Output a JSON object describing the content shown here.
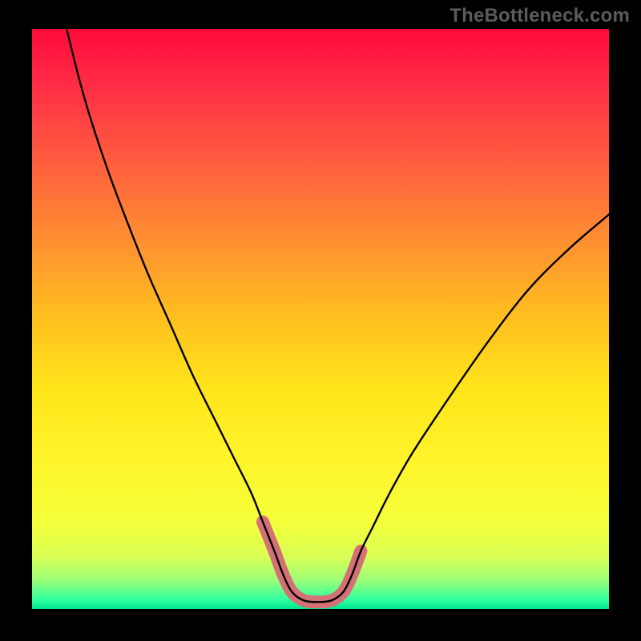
{
  "watermark": {
    "text": "TheBottleneck.com"
  },
  "gradient": {
    "stops": [
      {
        "offset": 0.0,
        "color": "#ff0a3a"
      },
      {
        "offset": 0.1,
        "color": "#ff2e46"
      },
      {
        "offset": 0.22,
        "color": "#ff5a3f"
      },
      {
        "offset": 0.35,
        "color": "#ff8a33"
      },
      {
        "offset": 0.5,
        "color": "#ffc01f"
      },
      {
        "offset": 0.62,
        "color": "#ffe51a"
      },
      {
        "offset": 0.74,
        "color": "#fff42a"
      },
      {
        "offset": 0.85,
        "color": "#f4ff3a"
      },
      {
        "offset": 0.91,
        "color": "#d9ff55"
      },
      {
        "offset": 0.95,
        "color": "#9dff78"
      },
      {
        "offset": 0.985,
        "color": "#2dffa0"
      },
      {
        "offset": 1.0,
        "color": "#00e58b"
      }
    ]
  },
  "chart_data": {
    "type": "line",
    "title": "",
    "xlabel": "",
    "ylabel": "",
    "xlim": [
      0,
      100
    ],
    "ylim": [
      0,
      100
    ],
    "legend": false,
    "series": [
      {
        "name": "bottleneck-curve",
        "color": "#000000",
        "x": [
          6,
          8,
          10,
          13,
          16,
          20,
          24,
          28,
          32,
          35,
          38,
          40,
          42,
          43.5,
          45,
          47,
          49.5,
          52,
          54,
          55.5,
          57,
          59,
          62,
          66,
          72,
          79,
          86,
          93,
          100
        ],
        "y": [
          100,
          92,
          85,
          76,
          68,
          58,
          49,
          40,
          32,
          26,
          20,
          15,
          10,
          6,
          3,
          1.5,
          1.2,
          1.5,
          3,
          6,
          10,
          14,
          20,
          27,
          36,
          46,
          55,
          62,
          68
        ]
      },
      {
        "name": "highlight-band",
        "color": "#d37176",
        "stroke_width": 16,
        "x": [
          40,
          42,
          43.5,
          45,
          47,
          49.5,
          52,
          54,
          55.5,
          57
        ],
        "y": [
          15,
          10,
          6,
          3,
          1.5,
          1.2,
          1.5,
          3,
          6,
          10
        ]
      }
    ]
  }
}
